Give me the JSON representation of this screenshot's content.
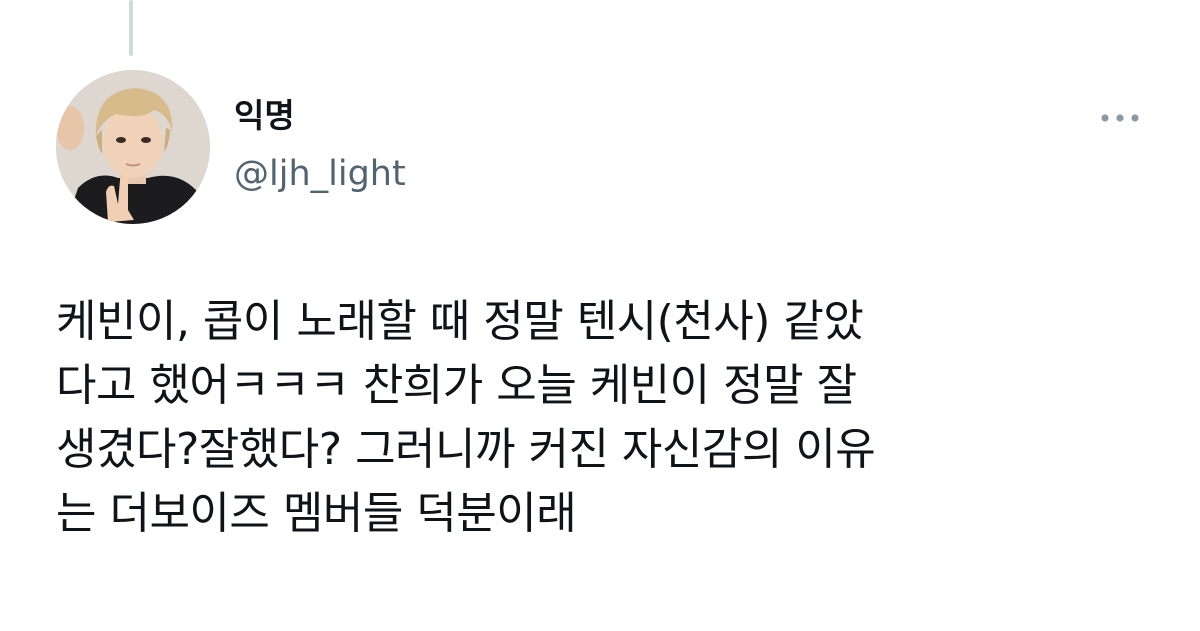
{
  "author": {
    "display_name": "익명",
    "handle": "@ljh_light"
  },
  "icons": {
    "more": "more-horizontal-icon",
    "avatar": "profile-photo"
  },
  "colors": {
    "text_primary": "#0f1419",
    "text_secondary": "#536471",
    "thread_line": "#cfd9de",
    "more_icon": "#8b98a5"
  },
  "tweet": {
    "lines": [
      "케빈이, 콥이 노래할 때 정말 텐시(천사) 같았",
      "다고 했어ㅋㅋㅋ  찬희가 오늘 케빈이 정말 잘",
      "생겼다?잘했다? 그러니까 커진 자신감의 이유",
      "는 더보이즈 멤버들 덕분이래"
    ]
  }
}
